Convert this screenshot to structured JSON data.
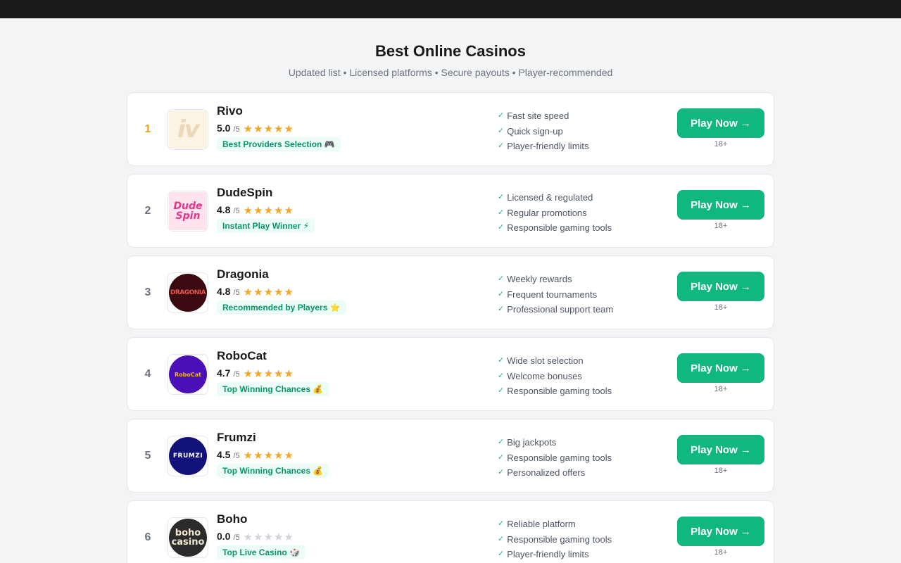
{
  "header": {
    "title": "Best Online Casinos",
    "subtitle": "Updated list • Licensed platforms • Secure payouts • Player-recommended"
  },
  "colors": {
    "accent": "#10b77f",
    "star": "#f5a623",
    "badge_bg": "#ecfdf5",
    "badge_text": "#059669",
    "rank_first": "#f0a500"
  },
  "casinos": [
    {
      "rank": "1",
      "name": "Rivo",
      "logo_text": "iv",
      "score": "5.0",
      "out_of": "/5",
      "stars_filled": 5,
      "badge": "Best Providers Selection 🎮",
      "features": [
        "Fast site speed",
        "Quick sign-up",
        "Player-friendly limits"
      ],
      "cta": "Play Now →",
      "age": "18+"
    },
    {
      "rank": "2",
      "name": "DudeSpin",
      "logo_text": "Dude Spin",
      "score": "4.8",
      "out_of": "/5",
      "stars_filled": 5,
      "badge": "Instant Play Winner ⚡",
      "features": [
        "Licensed & regulated",
        "Regular promotions",
        "Responsible gaming tools"
      ],
      "cta": "Play Now →",
      "age": "18+"
    },
    {
      "rank": "3",
      "name": "Dragonia",
      "logo_text": "DRAGONIA",
      "score": "4.8",
      "out_of": "/5",
      "stars_filled": 5,
      "badge": "Recommended by Players ⭐",
      "features": [
        "Weekly rewards",
        "Frequent tournaments",
        "Professional support team"
      ],
      "cta": "Play Now →",
      "age": "18+"
    },
    {
      "rank": "4",
      "name": "RoboCat",
      "logo_text": "RoboCat",
      "score": "4.7",
      "out_of": "/5",
      "stars_filled": 5,
      "badge": "Top Winning Chances 💰",
      "features": [
        "Wide slot selection",
        "Welcome bonuses",
        "Responsible gaming tools"
      ],
      "cta": "Play Now →",
      "age": "18+"
    },
    {
      "rank": "5",
      "name": "Frumzi",
      "logo_text": "FRUMZI",
      "score": "4.5",
      "out_of": "/5",
      "stars_filled": 5,
      "badge": "Top Winning Chances 💰",
      "features": [
        "Big jackpots",
        "Responsible gaming tools",
        "Personalized offers"
      ],
      "cta": "Play Now →",
      "age": "18+"
    },
    {
      "rank": "6",
      "name": "Boho",
      "logo_text": "boho casino",
      "score": "0.0",
      "out_of": "/5",
      "stars_filled": 0,
      "badge": "Top Live Casino 🎲",
      "features": [
        "Reliable platform",
        "Responsible gaming tools",
        "Player-friendly limits"
      ],
      "cta": "Play Now →",
      "age": "18+"
    }
  ]
}
